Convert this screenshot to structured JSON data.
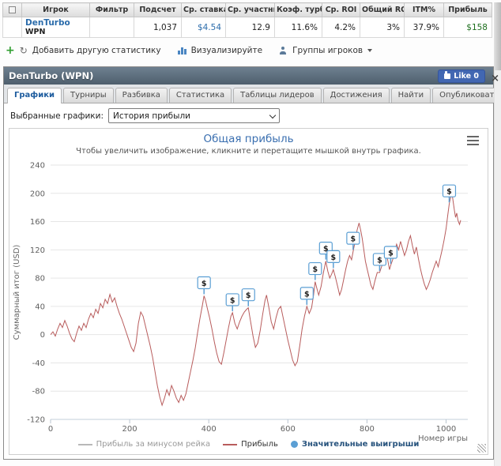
{
  "stats_table": {
    "columns": [
      "Игрок",
      "Фильтр",
      "Подсчет",
      "Ср. ставка",
      "Ср. участник",
      "Коэф. турбо",
      "Ср. ROI",
      "Общий ROI",
      "ITM%",
      "Прибыль"
    ],
    "row": {
      "player": "DenTurbo",
      "network": "WPN",
      "filter": "",
      "count": "1,037",
      "avg_stake": "$4.54",
      "avg_entrants": "12.9",
      "turbo_ratio": "11.6%",
      "avg_roi": "4.2%",
      "total_roi": "3%",
      "itm_pct": "37.9%",
      "profit": "$158"
    }
  },
  "toolbar": {
    "add_stat": "Добавить другую статистику",
    "visualize": "Визуализируйте",
    "player_groups": "Группы игроков"
  },
  "panel": {
    "title": "DenTurbo (WPN)",
    "like_label": "Like 0",
    "like_color": "#4267b2",
    "tabs": [
      "Графики",
      "Турниры",
      "Разбивка",
      "Статистика",
      "Таблицы лидеров",
      "Достижения",
      "Найти",
      "Опубликовать"
    ],
    "active_tab": "Графики",
    "selected_graphs_label": "Выбранные графики:",
    "selected_graph": "История прибыли"
  },
  "chart_data": {
    "type": "line",
    "title": "Общая прибыль",
    "subtitle": "Чтобы увеличить изображение, кликните и перетащите мышкой внутрь графика.",
    "xlabel": "Номер игры",
    "ylabel": "Суммарный итог (USD)",
    "xlim": [
      0,
      1055
    ],
    "ylim": [
      -120,
      240
    ],
    "xticks": [
      0,
      200,
      400,
      600,
      800,
      1000
    ],
    "yticks": [
      -120,
      -80,
      -40,
      0,
      40,
      80,
      120,
      160,
      200,
      240
    ],
    "grid": "horizontal",
    "legend_position": "bottom",
    "series": [
      {
        "name": "Прибыль за минусом рейка",
        "color": "#b8b8b8",
        "visible": false,
        "points": []
      },
      {
        "name": "Прибыль",
        "color": "#b85c5c",
        "visible": true,
        "points": [
          [
            0,
            0
          ],
          [
            6,
            4
          ],
          [
            12,
            -2
          ],
          [
            18,
            8
          ],
          [
            24,
            16
          ],
          [
            30,
            10
          ],
          [
            36,
            20
          ],
          [
            42,
            12
          ],
          [
            48,
            2
          ],
          [
            54,
            -6
          ],
          [
            60,
            -10
          ],
          [
            66,
            2
          ],
          [
            72,
            12
          ],
          [
            78,
            6
          ],
          [
            84,
            16
          ],
          [
            90,
            10
          ],
          [
            96,
            22
          ],
          [
            102,
            30
          ],
          [
            108,
            24
          ],
          [
            114,
            36
          ],
          [
            120,
            30
          ],
          [
            126,
            44
          ],
          [
            132,
            38
          ],
          [
            138,
            50
          ],
          [
            144,
            44
          ],
          [
            150,
            57
          ],
          [
            156,
            46
          ],
          [
            162,
            52
          ],
          [
            168,
            40
          ],
          [
            174,
            30
          ],
          [
            180,
            22
          ],
          [
            186,
            12
          ],
          [
            192,
            2
          ],
          [
            198,
            -8
          ],
          [
            204,
            -18
          ],
          [
            210,
            -24
          ],
          [
            216,
            -12
          ],
          [
            222,
            16
          ],
          [
            228,
            32
          ],
          [
            234,
            26
          ],
          [
            240,
            12
          ],
          [
            246,
            -2
          ],
          [
            252,
            -16
          ],
          [
            258,
            -32
          ],
          [
            264,
            -52
          ],
          [
            270,
            -72
          ],
          [
            276,
            -88
          ],
          [
            282,
            -100
          ],
          [
            288,
            -90
          ],
          [
            294,
            -78
          ],
          [
            300,
            -86
          ],
          [
            306,
            -72
          ],
          [
            312,
            -80
          ],
          [
            318,
            -90
          ],
          [
            324,
            -96
          ],
          [
            330,
            -86
          ],
          [
            336,
            -93
          ],
          [
            342,
            -84
          ],
          [
            348,
            -68
          ],
          [
            354,
            -52
          ],
          [
            360,
            -36
          ],
          [
            366,
            -18
          ],
          [
            372,
            4
          ],
          [
            378,
            24
          ],
          [
            384,
            42
          ],
          [
            388,
            55
          ],
          [
            392,
            48
          ],
          [
            396,
            38
          ],
          [
            402,
            24
          ],
          [
            408,
            8
          ],
          [
            414,
            -10
          ],
          [
            420,
            -26
          ],
          [
            426,
            -38
          ],
          [
            432,
            -42
          ],
          [
            438,
            -26
          ],
          [
            444,
            -8
          ],
          [
            450,
            10
          ],
          [
            456,
            26
          ],
          [
            460,
            31
          ],
          [
            466,
            16
          ],
          [
            472,
            8
          ],
          [
            478,
            18
          ],
          [
            484,
            26
          ],
          [
            490,
            32
          ],
          [
            496,
            36
          ],
          [
            500,
            38
          ],
          [
            506,
            18
          ],
          [
            512,
            -2
          ],
          [
            518,
            -18
          ],
          [
            524,
            -12
          ],
          [
            530,
            6
          ],
          [
            536,
            28
          ],
          [
            542,
            48
          ],
          [
            546,
            56
          ],
          [
            552,
            38
          ],
          [
            558,
            18
          ],
          [
            564,
            8
          ],
          [
            570,
            24
          ],
          [
            576,
            36
          ],
          [
            582,
            40
          ],
          [
            588,
            24
          ],
          [
            594,
            8
          ],
          [
            600,
            -8
          ],
          [
            606,
            -22
          ],
          [
            612,
            -36
          ],
          [
            618,
            -44
          ],
          [
            624,
            -38
          ],
          [
            630,
            -16
          ],
          [
            636,
            8
          ],
          [
            642,
            26
          ],
          [
            648,
            40
          ],
          [
            654,
            30
          ],
          [
            660,
            38
          ],
          [
            665,
            56
          ],
          [
            669,
            75
          ],
          [
            674,
            64
          ],
          [
            678,
            56
          ],
          [
            684,
            68
          ],
          [
            690,
            88
          ],
          [
            696,
            104
          ],
          [
            701,
            90
          ],
          [
            706,
            80
          ],
          [
            711,
            86
          ],
          [
            715,
            92
          ],
          [
            720,
            82
          ],
          [
            726,
            68
          ],
          [
            731,
            56
          ],
          [
            736,
            64
          ],
          [
            741,
            78
          ],
          [
            746,
            92
          ],
          [
            751,
            104
          ],
          [
            756,
            112
          ],
          [
            761,
            106
          ],
          [
            765,
            118
          ],
          [
            770,
            132
          ],
          [
            775,
            148
          ],
          [
            780,
            158
          ],
          [
            784,
            148
          ],
          [
            788,
            136
          ],
          [
            792,
            120
          ],
          [
            796,
            104
          ],
          [
            800,
            94
          ],
          [
            805,
            82
          ],
          [
            810,
            70
          ],
          [
            815,
            64
          ],
          [
            820,
            76
          ],
          [
            826,
            88
          ],
          [
            832,
            88
          ],
          [
            838,
            98
          ],
          [
            843,
            110
          ],
          [
            848,
            118
          ],
          [
            853,
            104
          ],
          [
            857,
            92
          ],
          [
            860,
            98
          ],
          [
            865,
            106
          ],
          [
            870,
            118
          ],
          [
            875,
            128
          ],
          [
            880,
            120
          ],
          [
            885,
            132
          ],
          [
            890,
            122
          ],
          [
            895,
            112
          ],
          [
            900,
            120
          ],
          [
            905,
            132
          ],
          [
            910,
            140
          ],
          [
            915,
            126
          ],
          [
            920,
            114
          ],
          [
            925,
            124
          ],
          [
            930,
            108
          ],
          [
            935,
            94
          ],
          [
            940,
            82
          ],
          [
            945,
            72
          ],
          [
            950,
            64
          ],
          [
            955,
            70
          ],
          [
            960,
            78
          ],
          [
            965,
            88
          ],
          [
            970,
            96
          ],
          [
            975,
            104
          ],
          [
            980,
            96
          ],
          [
            985,
            108
          ],
          [
            990,
            120
          ],
          [
            995,
            134
          ],
          [
            1000,
            150
          ],
          [
            1004,
            168
          ],
          [
            1008,
            185
          ],
          [
            1012,
            196
          ],
          [
            1015,
            200
          ],
          [
            1018,
            188
          ],
          [
            1021,
            176
          ],
          [
            1024,
            166
          ],
          [
            1027,
            172
          ],
          [
            1030,
            162
          ],
          [
            1034,
            156
          ],
          [
            1037,
            162
          ]
        ]
      }
    ],
    "markers": {
      "name": "Значительные выигрыши",
      "color": "#5b9fd4",
      "symbol": "$",
      "points": [
        [
          388,
          55
        ],
        [
          460,
          31
        ],
        [
          500,
          38
        ],
        [
          648,
          40
        ],
        [
          669,
          75
        ],
        [
          696,
          104
        ],
        [
          715,
          92
        ],
        [
          765,
          118
        ],
        [
          832,
          88
        ],
        [
          860,
          98
        ],
        [
          1008,
          185
        ]
      ]
    }
  }
}
